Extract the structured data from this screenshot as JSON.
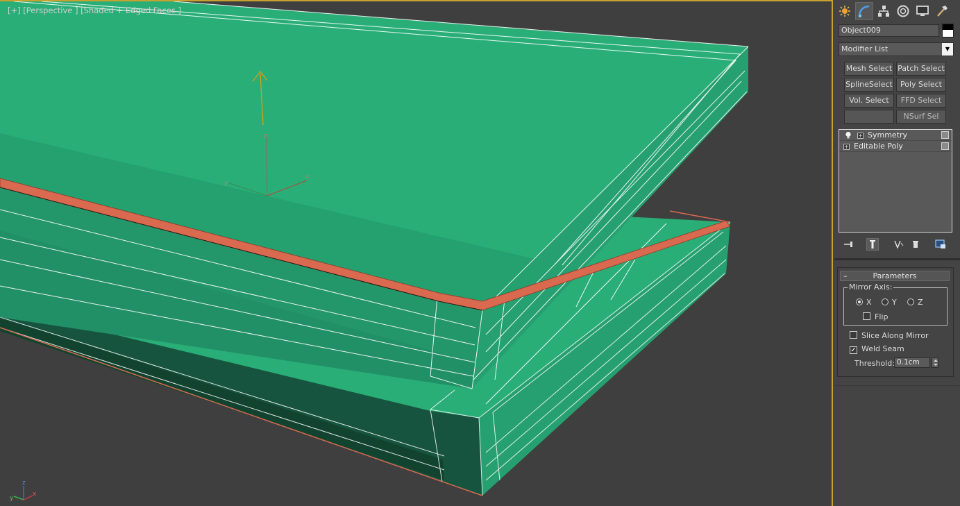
{
  "viewport": {
    "label": "[+] [Perspective ] [Shaded + Edged Faces ]",
    "gizmo": {
      "x": "x",
      "y": "y",
      "z": "z"
    },
    "world_axis": {
      "x": "x",
      "y": "y",
      "z": "z"
    },
    "colors": {
      "mesh_top": "#2aae78",
      "mesh_side": "#23966a",
      "mesh_dark": "#144a36",
      "selected_edge": "#d9694f",
      "background": "#3f3f3f",
      "active_border": "#c8a230"
    }
  },
  "command_panel": {
    "tabs": [
      {
        "name": "create-tab",
        "icon": "create-star-icon"
      },
      {
        "name": "modify-tab",
        "icon": "modify-curve-icon"
      },
      {
        "name": "hierarchy-tab",
        "icon": "hierarchy-icon"
      },
      {
        "name": "motion-tab",
        "icon": "motion-wheel-icon"
      },
      {
        "name": "display-tab",
        "icon": "display-monitor-icon"
      },
      {
        "name": "utilities-tab",
        "icon": "utilities-hammer-icon"
      }
    ],
    "object_name": "Object009",
    "modifier_list": "Modifier List",
    "modifier_buttons": [
      "Mesh Select",
      "Patch Select",
      "SplineSelect",
      "Poly Select",
      "Vol. Select",
      "FFD Select",
      "",
      "NSurf Sel"
    ],
    "stack": [
      {
        "label": "Symmetry"
      },
      {
        "label": "Editable Poly"
      }
    ],
    "parameters": {
      "title": "Parameters",
      "collapse": "–",
      "mirror_axis_title": "Mirror Axis:",
      "axes": [
        "X",
        "Y",
        "Z"
      ],
      "selected_axis": "X",
      "flip": "Flip",
      "slice_along_mirror": "Slice Along Mirror",
      "weld_seam": "Weld Seam",
      "weld_seam_checked": true,
      "threshold_label": "Threshold:",
      "threshold_value": "0.1cm"
    }
  }
}
